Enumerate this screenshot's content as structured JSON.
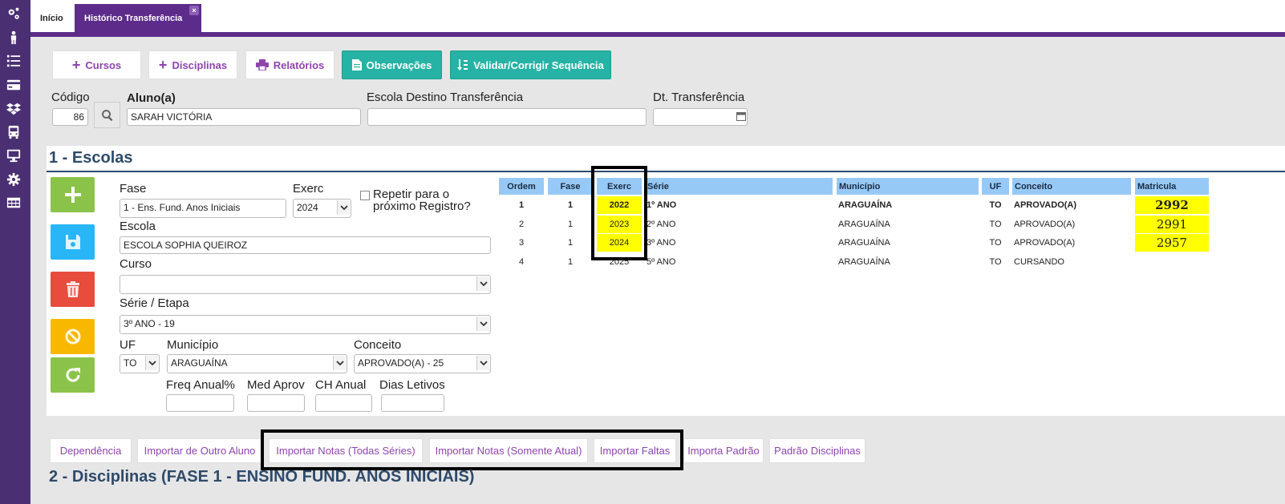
{
  "tabs": {
    "inicio": "Início",
    "historico": "Histórico Transferência",
    "close": "×"
  },
  "toolbar": {
    "cursos": "Cursos",
    "disciplinas": "Disciplinas",
    "relatorios": "Relatórios",
    "observacoes": "Observações",
    "validar": "Validar/Corrigir Sequência"
  },
  "header": {
    "codigo_label": "Código",
    "codigo_value": "86",
    "aluno_label": "Aluno(a)",
    "aluno_value": "SARAH VICTÓRIA",
    "escola_destino_label": "Escola Destino Transferência",
    "escola_destino_value": "",
    "dt_transferencia_label": "Dt. Transferência",
    "dt_transferencia_value": ""
  },
  "section1": {
    "title": "1 - Escolas",
    "fase_label": "Fase",
    "fase_value": "1 - Ens. Fund. Anos Iniciais",
    "exerc_label": "Exerc",
    "exerc_value": "2024",
    "repetir_label_1": "Repetir para o",
    "repetir_label_2": "próximo Registro?",
    "escola_label": "Escola",
    "escola_value": "ESCOLA SOPHIA QUEIROZ",
    "curso_label": "Curso",
    "curso_value": "",
    "serie_label": "Série / Etapa",
    "serie_value": "3º ANO - 19",
    "uf_label": "UF",
    "uf_value": "TO",
    "municipio_label": "Município",
    "municipio_value": "ARAGUAÍNA",
    "conceito_label": "Conceito",
    "conceito_value": "APROVADO(A) - 25",
    "freq_label": "Freq Anual%",
    "med_label": "Med Aprov",
    "ch_label": "CH Anual",
    "dias_label": "Dias Letivos"
  },
  "table": {
    "headers": {
      "ordem": "Ordem",
      "fase": "Fase",
      "exerc": "Exerc",
      "serie": "Série",
      "municipio": "Município",
      "uf": "UF",
      "conceito": "Conceito",
      "matricula": "Matricula"
    },
    "rows": [
      {
        "ordem": "1",
        "fase": "1",
        "exerc": "2022",
        "serie": "1º ANO",
        "municipio": "ARAGUAÍNA",
        "uf": "TO",
        "conceito": "APROVADO(A)",
        "matricula": "2992"
      },
      {
        "ordem": "2",
        "fase": "1",
        "exerc": "2023",
        "serie": "2º ANO",
        "municipio": "ARAGUAÍNA",
        "uf": "TO",
        "conceito": "APROVADO(A)",
        "matricula": "2991"
      },
      {
        "ordem": "3",
        "fase": "1",
        "exerc": "2024",
        "serie": "3º ANO",
        "municipio": "ARAGUAÍNA",
        "uf": "TO",
        "conceito": "APROVADO(A)",
        "matricula": "2957"
      },
      {
        "ordem": "4",
        "fase": "1",
        "exerc": "2025",
        "serie": "5º ANO",
        "municipio": "ARAGUAÍNA",
        "uf": "TO",
        "conceito": "CURSANDO",
        "matricula": ""
      }
    ]
  },
  "bottom_tabs": {
    "dependencia": "Dependência",
    "importar_outro": "Importar de Outro Aluno",
    "importar_todas": "Importar Notas (Todas Séries)",
    "importar_atual": "Importar Notas (Somente Atual)",
    "importar_faltas": "Importar Faltas",
    "importa_padrao": "Importa Padrão",
    "padrao_disciplinas": "Padrão Disciplinas"
  },
  "section2": {
    "title": "2 - Disciplinas (FASE 1 - ENSINO FUND. ANOS INICIAIS)"
  },
  "colors": {
    "sidebar": "#4a2f73",
    "tab_accent": "#5d2c8a",
    "link_purple": "#8e44ad",
    "teal": "#26b3a5",
    "green": "#8bc34a",
    "blue": "#29b6f6",
    "red": "#e74c3c",
    "yellow_btn": "#f9b800",
    "table_header": "#97c9f7",
    "highlight": "#ffff00"
  },
  "icons": [
    "cogs-icon",
    "person-icon",
    "list-icon",
    "card-icon",
    "dropbox-icon",
    "bus-icon",
    "monitor-icon",
    "gear-icon",
    "table-icon"
  ]
}
